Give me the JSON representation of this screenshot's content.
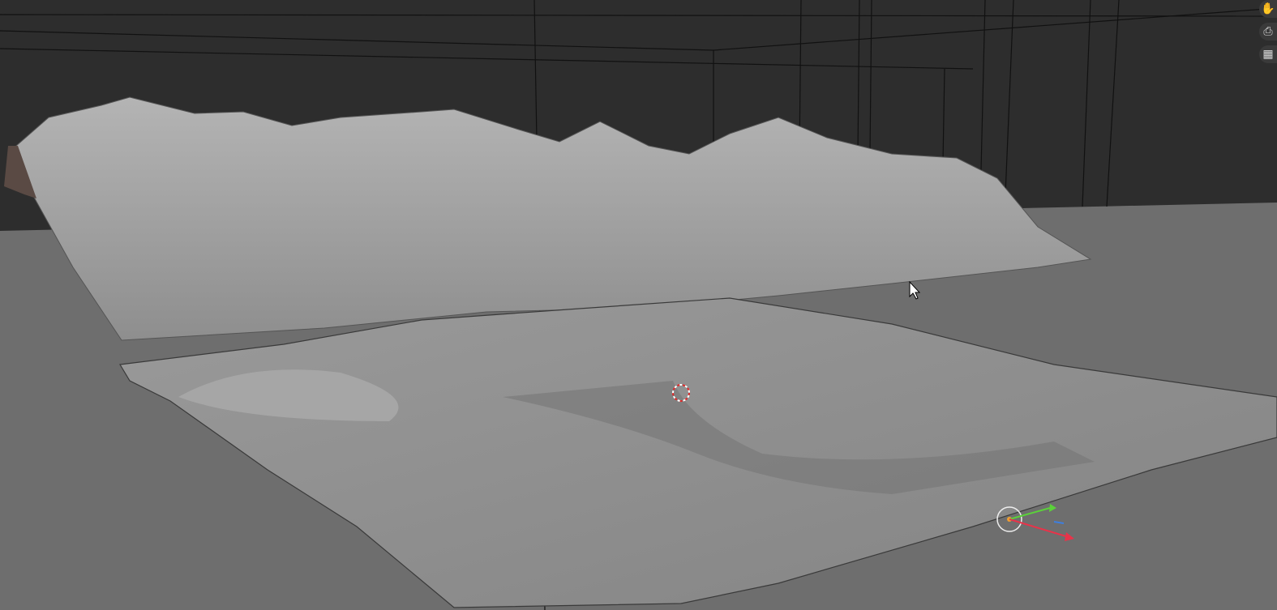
{
  "viewport": {
    "background_color": "#2d2d2d",
    "floor_color": "#6e6e6e",
    "terrain_color": "#8f8f8f",
    "mountain_color": "#a3a3a3"
  },
  "navigation_icons": [
    "hand-pan-icon",
    "camera-icon",
    "grid-perspective-icon"
  ],
  "gizmo": {
    "x_color": "#e8334a",
    "y_color": "#5bd13a",
    "z_color": "#3d7fe0"
  },
  "cursor_3d": {
    "colors": [
      "#e02828",
      "#ffffff"
    ]
  }
}
